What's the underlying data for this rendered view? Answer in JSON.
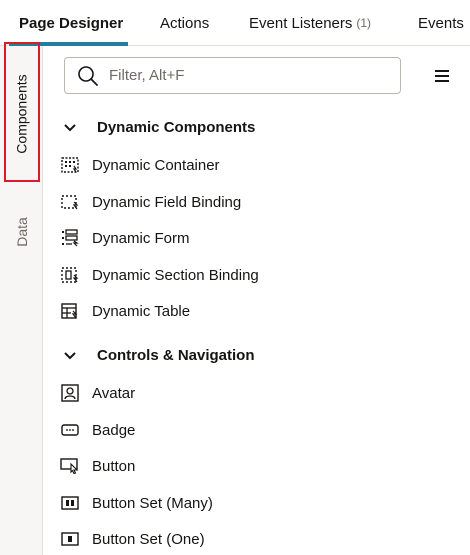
{
  "tabs": [
    {
      "label": "Page Designer",
      "count": ""
    },
    {
      "label": "Actions",
      "count": ""
    },
    {
      "label": "Event Listeners",
      "count": "(1)"
    },
    {
      "label": "Events",
      "count": ""
    }
  ],
  "side_tabs": {
    "components": "Components",
    "data": "Data"
  },
  "search": {
    "placeholder": "Filter, Alt+F",
    "value": ""
  },
  "groups": [
    {
      "title": "Dynamic Components",
      "items": [
        {
          "label": "Dynamic Container",
          "icon": "dynamic-container-icon"
        },
        {
          "label": "Dynamic Field Binding",
          "icon": "dynamic-field-binding-icon"
        },
        {
          "label": "Dynamic Form",
          "icon": "dynamic-form-icon"
        },
        {
          "label": "Dynamic Section Binding",
          "icon": "dynamic-section-binding-icon"
        },
        {
          "label": "Dynamic Table",
          "icon": "dynamic-table-icon"
        }
      ]
    },
    {
      "title": "Controls & Navigation",
      "items": [
        {
          "label": "Avatar",
          "icon": "avatar-icon"
        },
        {
          "label": "Badge",
          "icon": "badge-icon"
        },
        {
          "label": "Button",
          "icon": "button-icon"
        },
        {
          "label": "Button Set (Many)",
          "icon": "button-set-many-icon"
        },
        {
          "label": "Button Set (One)",
          "icon": "button-set-one-icon"
        }
      ]
    }
  ],
  "colors": {
    "accent": "#227e9e",
    "highlight_border": "#d41f26",
    "rail_background": "#f7f6f4"
  }
}
